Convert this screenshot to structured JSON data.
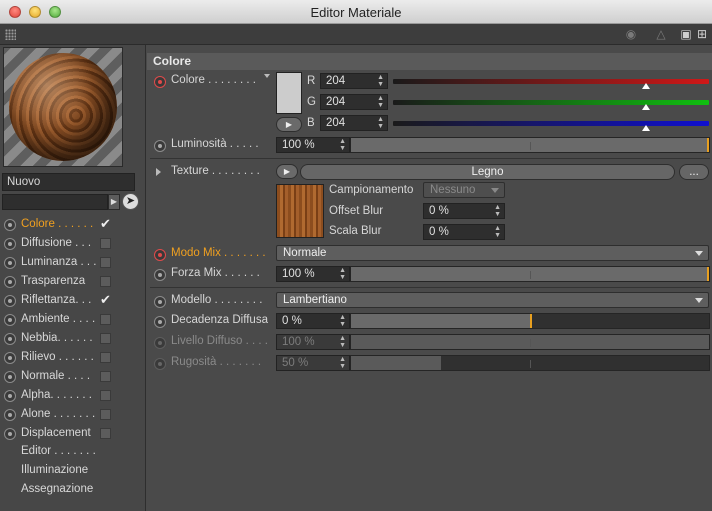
{
  "window": {
    "title": "Editor Materiale"
  },
  "left": {
    "name_value": "Nuovo",
    "channels": [
      {
        "label": "Colore . . . . . .",
        "checked": true,
        "active": true
      },
      {
        "label": "Diffusione . . .",
        "checked": false,
        "active": false
      },
      {
        "label": "Luminanza . . .",
        "checked": false,
        "active": false
      },
      {
        "label": "Trasparenza",
        "checked": false,
        "active": false
      },
      {
        "label": "Riflettanza. . .",
        "checked": true,
        "active": false
      },
      {
        "label": "Ambiente . . . .",
        "checked": false,
        "active": false
      },
      {
        "label": "Nebbia. . . . . .",
        "checked": false,
        "active": false
      },
      {
        "label": "Rilievo . . . . . .",
        "checked": false,
        "active": false
      },
      {
        "label": "Normale . . . .",
        "checked": false,
        "active": false
      },
      {
        "label": "Alpha. . . . . . .",
        "checked": false,
        "active": false
      },
      {
        "label": "Alone . . . . . . .",
        "checked": false,
        "active": false
      },
      {
        "label": "Displacement",
        "checked": false,
        "active": false
      }
    ],
    "links": [
      "Editor . . . . . . .",
      "Illuminazione",
      "Assegnazione"
    ]
  },
  "colore": {
    "section_title": "Colore",
    "label": "Colore . . . . . . . .",
    "swatch_color": "#cccccc",
    "r_label": "R",
    "r_value": "204",
    "g_label": "G",
    "g_value": "204",
    "b_label": "B",
    "b_value": "204",
    "r_bar": "#d01818",
    "g_bar": "#10c010",
    "b_bar": "#1010d0",
    "channel_level": 0.8
  },
  "luminosita": {
    "label": "Luminosità . . . . .",
    "value": "100 %",
    "level": 1.0
  },
  "texture": {
    "label": "Texture . . . . . . . .",
    "name": "Legno",
    "more_label": "...",
    "campionamento_label": "Campionamento",
    "campionamento_value": "Nessuno",
    "offset_blur_label": "Offset Blur",
    "offset_blur_value": "0 %",
    "scala_blur_label": "Scala Blur",
    "scala_blur_value": "0 %"
  },
  "modo_mix": {
    "label": "Modo Mix . . . . . . .",
    "value": "Normale"
  },
  "forza_mix": {
    "label": "Forza Mix . . . . . .",
    "value": "100 %",
    "level": 1.0
  },
  "modello": {
    "label": "Modello . . . . . . . .",
    "value": "Lambertiano"
  },
  "decadenza": {
    "label": "Decadenza Diffusa",
    "value": "0 %",
    "level": 0.5
  },
  "livello": {
    "label": "Livello Diffuso . . . .",
    "value": "100 %",
    "level": 1.0
  },
  "rugosita": {
    "label": "Rugosità . . . . . . .",
    "value": "50 %",
    "level": 0.25
  }
}
